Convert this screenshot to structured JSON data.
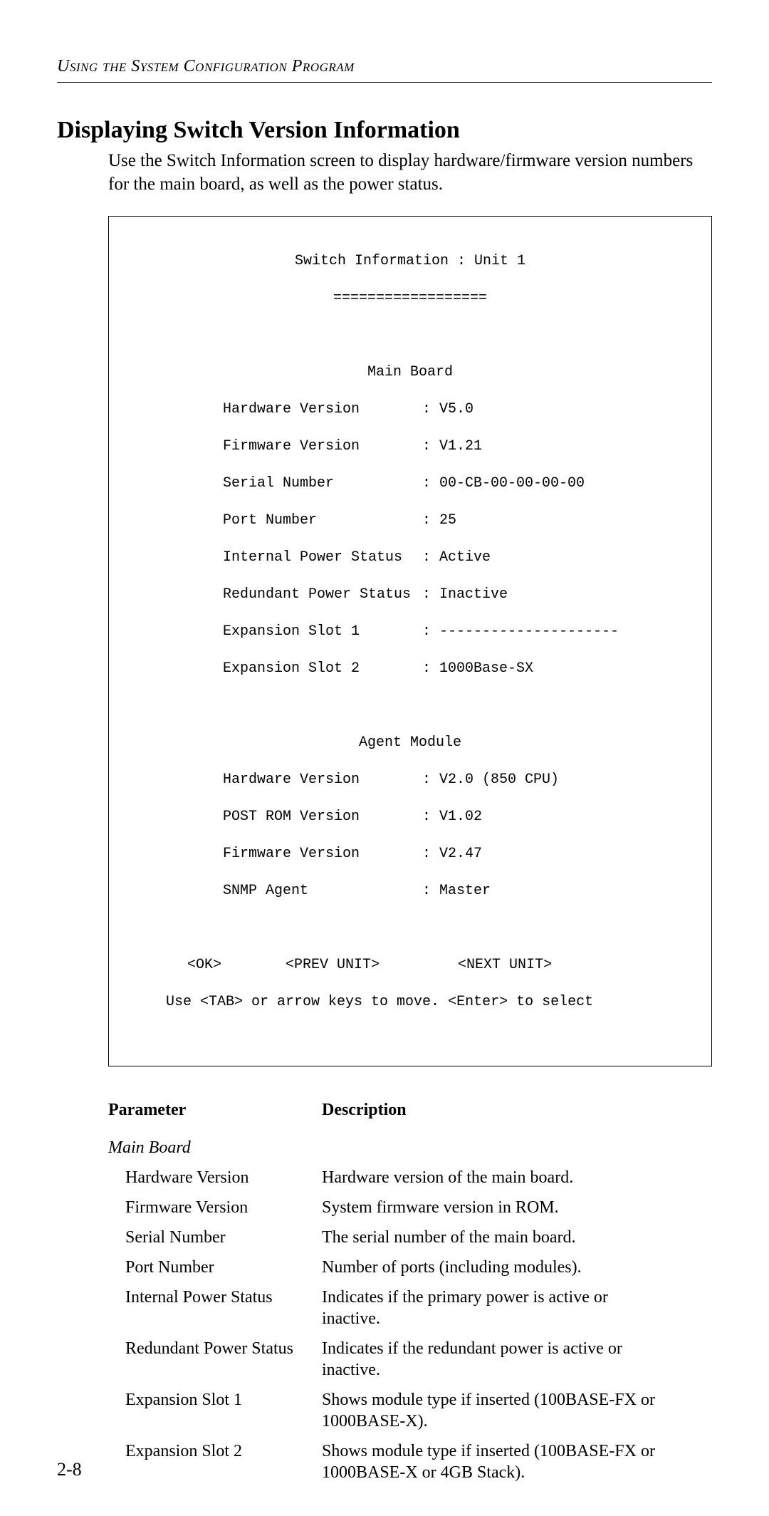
{
  "running_head": "Using the System Configuration Program",
  "section_title": "Displaying Switch Version Information",
  "intro_para": "Use the Switch Information screen to display hardware/firmware version numbers for the main board, as well as the power status.",
  "terminal": {
    "title": "Switch Information : Unit 1",
    "underline": "==================",
    "main_board_header": "Main Board",
    "main_board": [
      {
        "label": "Hardware Version",
        "value": "V5.0"
      },
      {
        "label": "Firmware Version",
        "value": "V1.21"
      },
      {
        "label": "Serial Number",
        "value": "00-CB-00-00-00-00"
      },
      {
        "label": "Port Number",
        "value": "25"
      },
      {
        "label": "Internal Power Status",
        "value": "Active"
      },
      {
        "label": "Redundant Power Status",
        "value": "Inactive"
      },
      {
        "label": "Expansion Slot 1",
        "value": "---------------------"
      },
      {
        "label": "Expansion Slot 2",
        "value": "1000Base-SX"
      }
    ],
    "agent_module_header": "Agent Module",
    "agent_module": [
      {
        "label": "Hardware Version",
        "value": "V2.0 (850 CPU)"
      },
      {
        "label": "POST ROM Version",
        "value": "V1.02"
      },
      {
        "label": "Firmware Version",
        "value": "V2.47"
      },
      {
        "label": "SNMP Agent",
        "value": "Master"
      }
    ],
    "nav_ok": "<OK>",
    "nav_prev": "<PREV UNIT>",
    "nav_next": "<NEXT UNIT>",
    "hint": "Use <TAB> or arrow keys to move. <Enter> to select"
  },
  "table": {
    "head_param": "Parameter",
    "head_desc": "Description",
    "group_main_board": "Main Board",
    "rows": [
      {
        "param": "Hardware Version",
        "desc": "Hardware version of the main board."
      },
      {
        "param": "Firmware Version",
        "desc": "System firmware version in ROM."
      },
      {
        "param": "Serial Number",
        "desc": "The serial number of the main board."
      },
      {
        "param": "Port Number",
        "desc": "Number of ports (including modules)."
      },
      {
        "param": "Internal Power Status",
        "desc": "Indicates if the primary power is active or inactive."
      },
      {
        "param": "Redundant Power Status",
        "desc": "Indicates if the redundant power is active or inactive."
      },
      {
        "param": "Expansion Slot 1",
        "desc": "Shows module type if inserted (100BASE-FX or 1000BASE-X)."
      },
      {
        "param": "Expansion Slot 2",
        "desc": "Shows module type if inserted (100BASE-FX or 1000BASE-X or 4GB Stack)."
      }
    ]
  },
  "page_number": "2-8"
}
